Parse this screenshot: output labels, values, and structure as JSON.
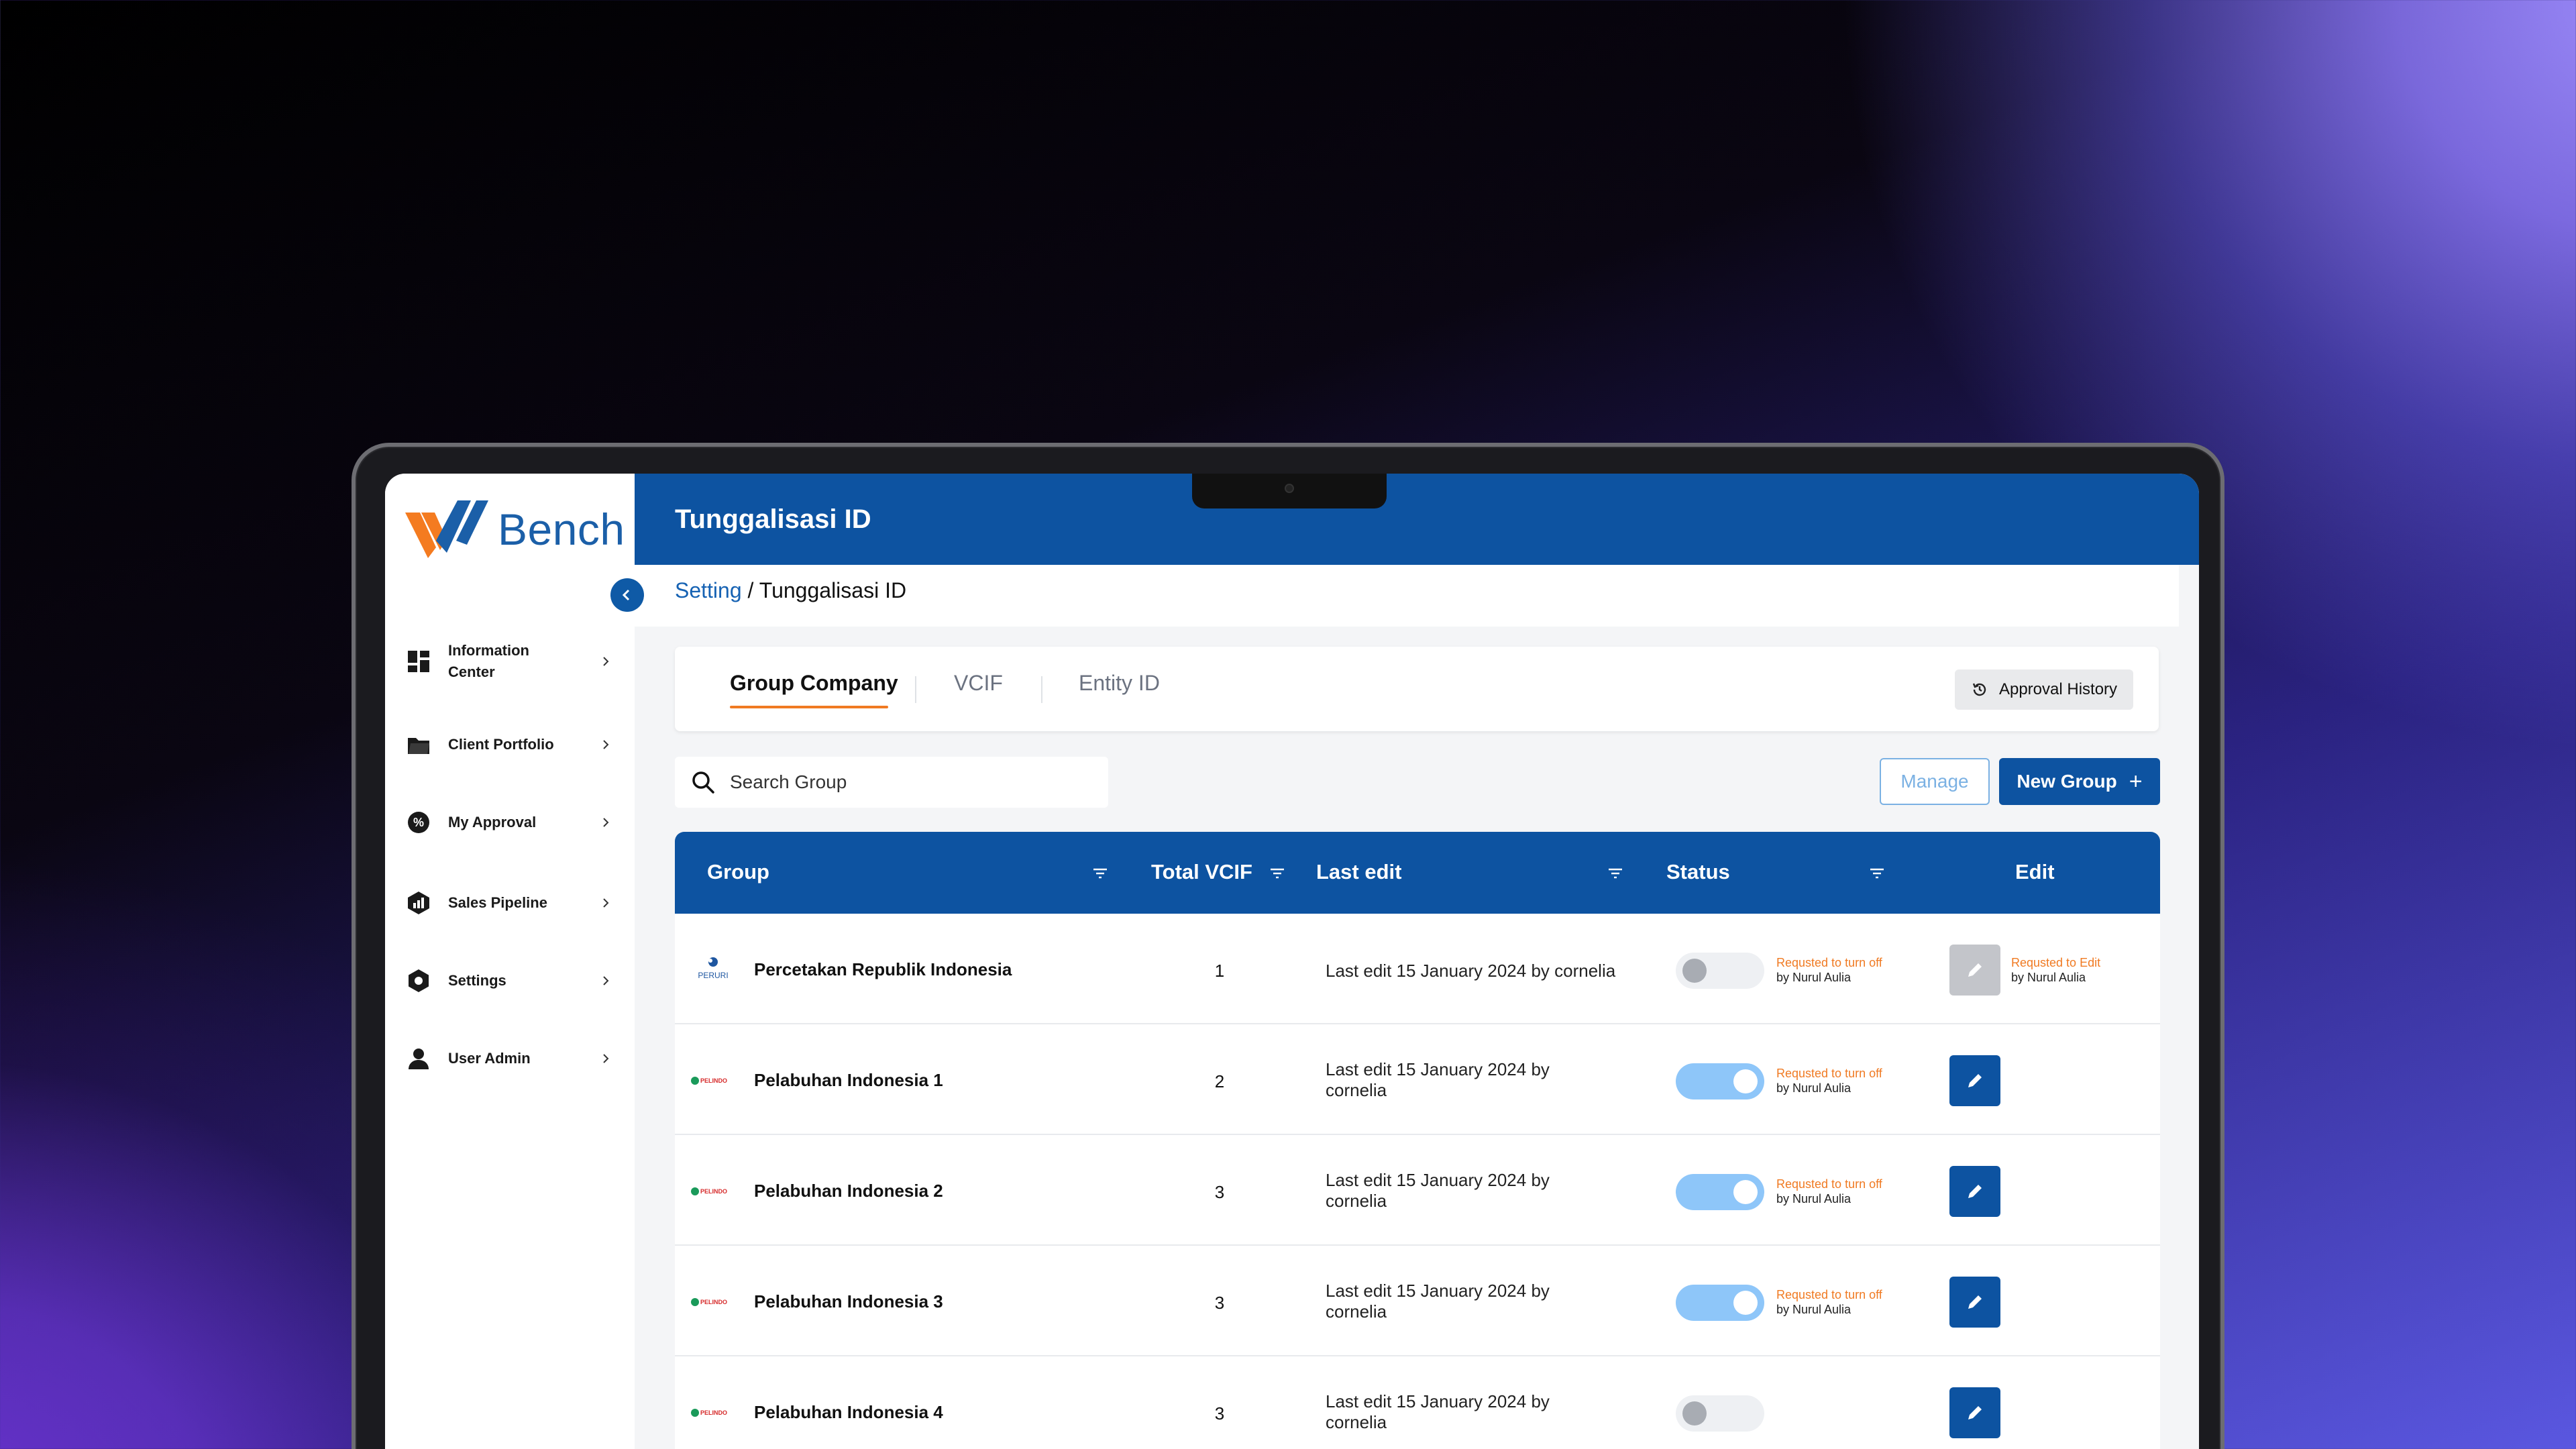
{
  "app": {
    "logo_text": "Bench"
  },
  "header": {
    "title": "Tunggalisasi ID"
  },
  "breadcrumb": {
    "parent": "Setting",
    "separator": " / ",
    "current": "Tunggalisasi ID"
  },
  "sidebar": {
    "items": [
      {
        "label": "Information Center",
        "icon": "dashboard-icon"
      },
      {
        "label": "Client Portfolio",
        "icon": "folder-icon"
      },
      {
        "label": "My Approval",
        "icon": "approval-badge-icon"
      },
      {
        "label": "Sales Pipeline",
        "icon": "pipeline-icon"
      },
      {
        "label": "Settings",
        "icon": "gear-icon"
      },
      {
        "label": "User Admin",
        "icon": "user-icon"
      }
    ]
  },
  "tabs": [
    {
      "label": "Group Company",
      "active": true
    },
    {
      "label": "VCIF",
      "active": false
    },
    {
      "label": "Entity ID",
      "active": false
    }
  ],
  "toolbar": {
    "approval_history": "Approval History",
    "search_placeholder": "Search Group",
    "manage": "Manage",
    "new_group": "New Group",
    "new_group_icon": "+"
  },
  "table": {
    "columns": [
      "Group",
      "Total VCIF",
      "Last edit",
      "Status",
      "Edit"
    ],
    "rows": [
      {
        "logo": "PERURI",
        "name": "Percetakan Republik Indonesia",
        "total": "1",
        "last_edit": "Last edit 15 January 2024 by cornelia",
        "status_on": false,
        "status_note": "Requsted to turn off",
        "status_by": "by Nurul Aulia",
        "edit_disabled": true,
        "edit_note": "Requsted to Edit",
        "edit_by": "by Nurul Aulia"
      },
      {
        "logo": "PELINDO",
        "name": "Pelabuhan Indonesia 1",
        "total": "2",
        "last_edit": "Last edit 15 January 2024 by cornelia",
        "status_on": true,
        "status_note": "Requsted to turn off",
        "status_by": "by Nurul Aulia",
        "edit_disabled": false,
        "edit_note": "",
        "edit_by": ""
      },
      {
        "logo": "PELINDO",
        "name": "Pelabuhan Indonesia 2",
        "total": "3",
        "last_edit": "Last edit 15 January 2024 by cornelia",
        "status_on": true,
        "status_note": "Requsted to turn off",
        "status_by": "by Nurul Aulia",
        "edit_disabled": false,
        "edit_note": "",
        "edit_by": ""
      },
      {
        "logo": "PELINDO",
        "name": "Pelabuhan Indonesia 3",
        "total": "3",
        "last_edit": "Last edit 15 January 2024 by cornelia",
        "status_on": true,
        "status_note": "Requsted to turn off",
        "status_by": "by Nurul Aulia",
        "edit_disabled": false,
        "edit_note": "",
        "edit_by": ""
      },
      {
        "logo": "PELINDO",
        "name": "Pelabuhan Indonesia 4",
        "total": "3",
        "last_edit": "Last edit 15 January 2024 by cornelia",
        "status_on": false,
        "status_note": "",
        "status_by": "",
        "edit_disabled": false,
        "edit_note": "",
        "edit_by": ""
      }
    ]
  },
  "colors": {
    "primary": "#0d53a1",
    "accent_orange": "#f07a22",
    "toggle_on": "#8ec6f9",
    "logo_orange": "#f47b20",
    "logo_blue": "#1b5fa8"
  }
}
